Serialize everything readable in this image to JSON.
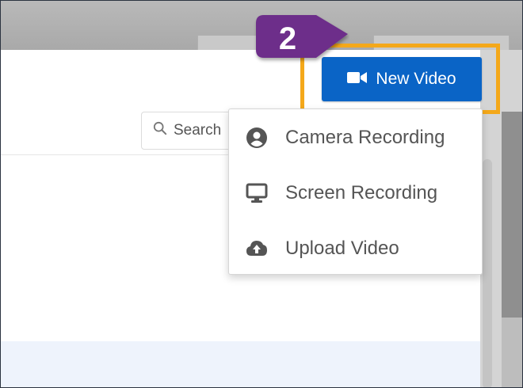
{
  "search": {
    "label": "Search"
  },
  "toolbar": {
    "new_video_label": "New Video"
  },
  "step_badge": {
    "number": "2",
    "color": "#6d2f8a"
  },
  "highlight_color": "#f4a81a",
  "accent_color": "#0a64c6",
  "menu": {
    "items": [
      {
        "label": "Camera Recording",
        "icon": "user-circle-icon"
      },
      {
        "label": "Screen Recording",
        "icon": "monitor-icon"
      },
      {
        "label": "Upload Video",
        "icon": "cloud-upload-icon"
      }
    ]
  }
}
